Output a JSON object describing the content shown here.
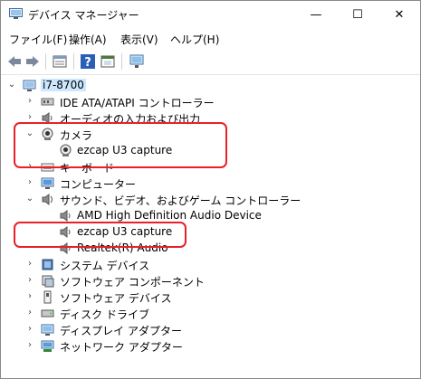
{
  "window": {
    "title": "デバイス マネージャー",
    "minimize_glyph": "—",
    "maximize_glyph": "☐",
    "close_glyph": "✕"
  },
  "menu": [
    "ファイル(F)",
    "操作(A)",
    "表示(V)",
    "ヘルプ(H)"
  ],
  "toolbar": [
    "back-icon",
    "forward-icon",
    "properties-icon",
    "help-icon",
    "update-driver-icon",
    "scan-hardware-icon"
  ],
  "tree": {
    "root": "i7-8700",
    "items": [
      {
        "label": "IDE ATA/ATAPI コントローラー",
        "icon": "ide-icon",
        "level": 1,
        "expander": "collapsed"
      },
      {
        "label": "オーディオの入力および出力",
        "icon": "speaker-icon",
        "level": 1,
        "expander": "collapsed"
      },
      {
        "label": "カメラ",
        "icon": "camera-icon",
        "level": 1,
        "expander": "expanded"
      },
      {
        "label": "ezcap U3 capture",
        "icon": "camera-icon",
        "level": 2,
        "expander": "none"
      },
      {
        "label": "キーボード",
        "icon": "keyboard-icon",
        "level": 1,
        "expander": "collapsed"
      },
      {
        "label": "コンピューター",
        "icon": "computer-icon",
        "level": 1,
        "expander": "collapsed"
      },
      {
        "label": "サウンド、ビデオ、およびゲーム コントローラー",
        "icon": "sound-icon",
        "level": 1,
        "expander": "expanded"
      },
      {
        "label": "AMD High Definition Audio Device",
        "icon": "speaker-icon",
        "level": 2,
        "expander": "none"
      },
      {
        "label": "ezcap U3 capture",
        "icon": "speaker-icon",
        "level": 2,
        "expander": "none"
      },
      {
        "label": "Realtek(R) Audio",
        "icon": "speaker-icon",
        "level": 2,
        "expander": "none"
      },
      {
        "label": "システム デバイス",
        "icon": "system-icon",
        "level": 1,
        "expander": "collapsed"
      },
      {
        "label": "ソフトウェア コンポーネント",
        "icon": "component-icon",
        "level": 1,
        "expander": "collapsed"
      },
      {
        "label": "ソフトウェア デバイス",
        "icon": "software-device-icon",
        "level": 1,
        "expander": "collapsed"
      },
      {
        "label": "ディスク ドライブ",
        "icon": "disk-icon",
        "level": 1,
        "expander": "collapsed"
      },
      {
        "label": "ディスプレイ アダプター",
        "icon": "display-icon",
        "level": 1,
        "expander": "collapsed"
      },
      {
        "label": "ネットワーク アダプター",
        "icon": "network-icon",
        "level": 1,
        "expander": "collapsed"
      }
    ]
  },
  "colors": {
    "highlight": "#e8202b",
    "selection": "#cce8ff"
  }
}
